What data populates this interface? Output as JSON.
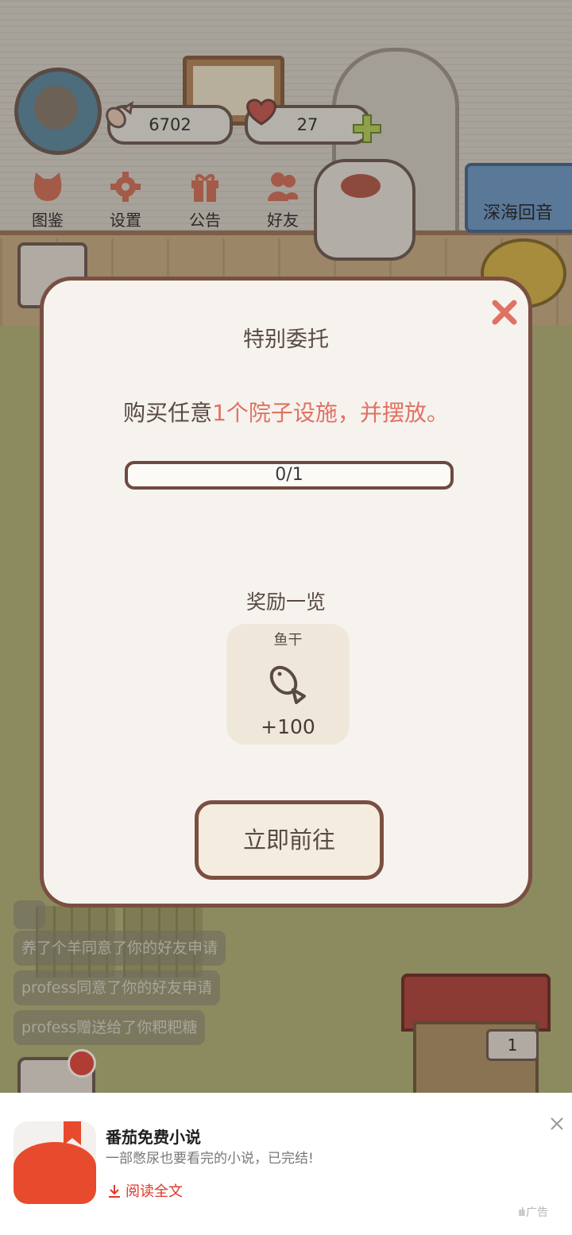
{
  "hud": {
    "fish_count": "6702",
    "heart_count": "27",
    "menu": [
      {
        "label": "图鉴",
        "icon": "cat-face-icon"
      },
      {
        "label": "设置",
        "icon": "gear-icon"
      },
      {
        "label": "公告",
        "icon": "gift-icon"
      },
      {
        "label": "好友",
        "icon": "friends-icon"
      }
    ],
    "sign_label": "深海回音"
  },
  "feed": [
    "养了个羊同意了你的好友申请",
    "profess同意了你的好友申请",
    "profess赠送给了你粑粑糖"
  ],
  "house_counter": "1",
  "modal": {
    "title": "特别委托",
    "task_prefix": "购买任意",
    "task_highlight": "1个院子设施，并摆放。",
    "progress_text": "0/1",
    "progress_fraction": 0,
    "rewards_title": "奖励一览",
    "reward": {
      "name": "鱼干",
      "icon": "fish-icon",
      "amount": "+100"
    },
    "go_button": "立即前往"
  },
  "ad": {
    "title": "番茄免费小说",
    "description": "一部憋尿也要看完的小说，已完结!",
    "cta": "阅读全文",
    "tag": "广告"
  },
  "colors": {
    "accent": "#e07264",
    "modal_border": "#7a4f42",
    "ad_red": "#e0362a"
  }
}
